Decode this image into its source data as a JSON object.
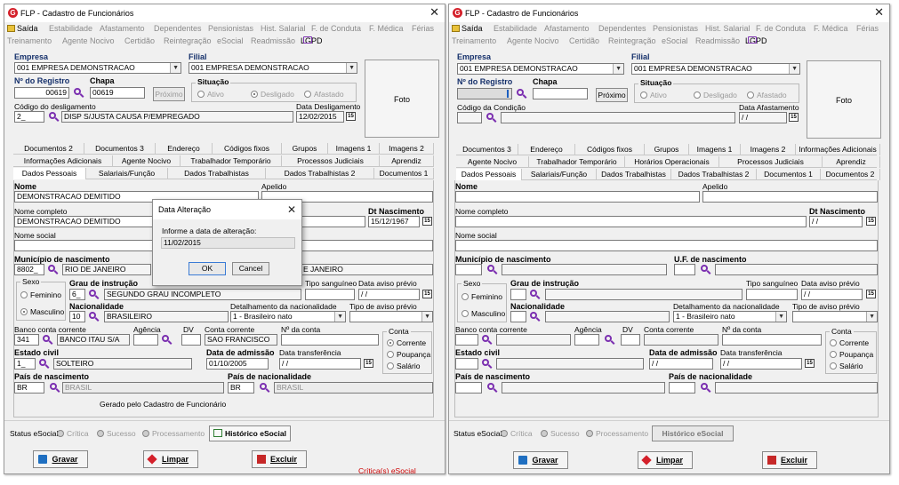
{
  "window_title": "FLP - Cadastro de Funcionários",
  "menu": {
    "saida": "Saída",
    "items1": [
      "Estabilidade",
      "Afastamento",
      "Dependentes",
      "Pensionistas",
      "Hist. Salarial",
      "F. de Conduta",
      "F. Médica",
      "Férias"
    ],
    "items2": [
      "Treinamento",
      "Agente Nocivo",
      "Certidão",
      "Reintegração",
      "eSocial",
      "Readmissão",
      "LGPD"
    ]
  },
  "labels": {
    "empresa": "Empresa",
    "filial": "Filial",
    "nr_registro": "Nº do Registro",
    "chapa": "Chapa",
    "proximo": "Próximo",
    "situacao": "Situação",
    "ativo": "Ativo",
    "desligado": "Desligado",
    "afastado": "Afastado",
    "foto": "Foto",
    "cod_desligamento": "Código do desligamento",
    "data_desligamento": "Data Desligamento",
    "cod_condicao": "Código da Condição",
    "data_afastamento": "Data Afastamento",
    "nome": "Nome",
    "apelido": "Apelido",
    "nome_completo": "Nome completo",
    "dt_nascimento": "Dt Nascimento",
    "nome_social": "Nome social",
    "municipio": "Município de nascimento",
    "uf": "U.F. de nascimento",
    "sexo": "Sexo",
    "feminino": "Feminino",
    "masculino": "Masculino",
    "grau_instrucao": "Grau de instrução",
    "tipo_sanguineo": "Tipo sanguíneo",
    "data_aviso": "Data aviso prévio",
    "nacionalidade": "Nacionalidade",
    "detalhamento": "Detalhamento da nacionalidade",
    "tipo_aviso": "Tipo de aviso prévio",
    "banco": "Banco conta corrente",
    "agencia": "Agência",
    "dv": "DV",
    "conta_corrente": "Conta corrente",
    "nr_conta": "Nº da conta",
    "conta": "Conta",
    "corrente": "Corrente",
    "poupanca": "Poupança",
    "salario": "Salário",
    "estado_civil": "Estado civil",
    "data_admissao": "Data de admissão",
    "data_transferencia": "Data transferência",
    "pais_nascimento": "País de nascimento",
    "pais_nacionalidade": "País de nacionalidade",
    "status_esocial": "Status eSocial:",
    "critica": "Crítica",
    "sucesso": "Sucesso",
    "processamento": "Processamento",
    "historico": "Histórico eSocial",
    "gravar": "Gravar",
    "limpar": "Limpar",
    "excluir": "Excluir"
  },
  "left": {
    "empresa": "001 EMPRESA DEMONSTRACAO",
    "filial": "001 EMPRESA DEMONSTRACAO",
    "nr_registro": "00619",
    "chapa": "00619",
    "cod_desligamento": "2_",
    "desligamento_desc": "DISP S/JUSTA CAUSA P/EMPREGADO",
    "data_desligamento": "12/02/2015",
    "tabs_row1": [
      "Documentos 2",
      "Documentos 3",
      "Endereço",
      "Códigos fixos",
      "Grupos",
      "Imagens 1",
      "Imagens 2"
    ],
    "tabs_row2": [
      "Informações Adicionais",
      "Agente Nocivo",
      "Trabalhador Temporário",
      "Processos Judiciais",
      "Aprendiz"
    ],
    "tabs_row3": [
      "Dados Pessoais",
      "Salariais/Função",
      "Dados Trabalhistas",
      "Dados Trabalhistas 2",
      "Documentos 1"
    ],
    "nome": "DEMONSTRACAO DEMITIDO",
    "nome_completo": "DEMONSTRACAO DEMITIDO",
    "dt_nascimento": "15/12/1967",
    "mun_code": "8802_",
    "mun_name": "RIO DE JANEIRO",
    "uf_name": "E JANEIRO",
    "grau_code": "6_",
    "grau_desc": "SEGUNDO GRAU INCOMPLETO",
    "data_aviso": " / /",
    "nac_code": "10",
    "nac_desc": "BRASILEIRO",
    "detalhamento": "1 - Brasileiro nato",
    "banco_code": "341",
    "banco_name": "BANCO ITAU S/A",
    "conta_corrente_name": "SAO FRANCISCO",
    "estado_code": "1_",
    "estado_desc": "SOLTEIRO",
    "data_admissao": "01/10/2005",
    "data_transferencia": " / /",
    "pais_nasc_code": "BR",
    "pais_nasc_name": "BRASIL",
    "pais_nac_code": "BR",
    "pais_nac_name": "BRASIL",
    "gerado": "Gerado pelo Cadastro de Funcionário",
    "criticas": "Crítica(s) eSocial"
  },
  "right": {
    "empresa": "001 EMPRESA DEMONSTRACAO",
    "filial": "001 EMPRESA DEMONSTRACAO",
    "data_afastamento": " / /",
    "tabs_row1": [
      "Documentos 3",
      "Endereço",
      "Códigos fixos",
      "Grupos",
      "Imagens 1",
      "Imagens 2",
      "Informações Adicionais"
    ],
    "tabs_row2": [
      "Agente Nocivo",
      "Trabalhador Temporário",
      "Horários Operacionais",
      "Processos Judiciais",
      "Aprendiz"
    ],
    "tabs_row3": [
      "Dados Pessoais",
      "Salariais/Função",
      "Dados Trabalhistas",
      "Dados Trabalhistas 2",
      "Documentos 1",
      "Documentos 2"
    ],
    "dt_nascimento": " / /",
    "data_aviso": " / /",
    "detalhamento": "1 - Brasileiro nato",
    "data_admissao": " / /",
    "data_transferencia": " / /"
  },
  "dialog": {
    "title": "Data Alteração",
    "prompt": "Informe a data de alteração:",
    "value": "11/02/2015",
    "ok": "OK",
    "cancel": "Cancel"
  },
  "colors": {
    "accent": "#d4202a",
    "label_navy": "#15306b",
    "critica_red": "#cc0000",
    "magnifier": "#7b2fb0"
  }
}
